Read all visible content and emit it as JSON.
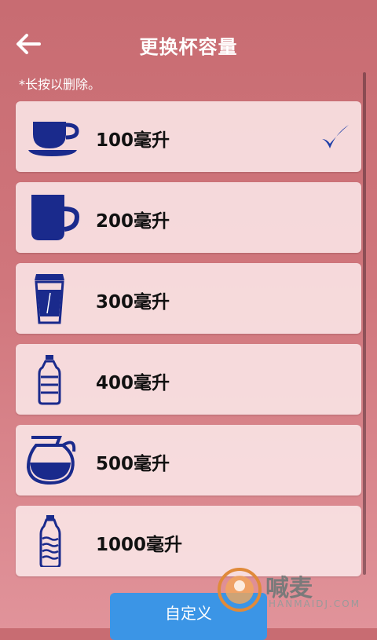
{
  "header": {
    "title": "更换杯容量"
  },
  "hint": "*长按以删除。",
  "items": [
    {
      "label": "100毫升",
      "icon": "cup-saucer-icon",
      "selected": true
    },
    {
      "label": "200毫升",
      "icon": "mug-icon",
      "selected": false
    },
    {
      "label": "300毫升",
      "icon": "takeaway-cup-icon",
      "selected": false
    },
    {
      "label": "400毫升",
      "icon": "small-bottle-icon",
      "selected": false
    },
    {
      "label": "500毫升",
      "icon": "jug-icon",
      "selected": false
    },
    {
      "label": "1000毫升",
      "icon": "large-bottle-icon",
      "selected": false
    }
  ],
  "custom_button": {
    "label": "自定义"
  },
  "watermark": {
    "text": "喊麦",
    "sub": "HANMAIDJ.COM"
  },
  "colors": {
    "icon": "#1a2a8c",
    "check": "#1f3fa8",
    "button": "#3b95e6"
  }
}
